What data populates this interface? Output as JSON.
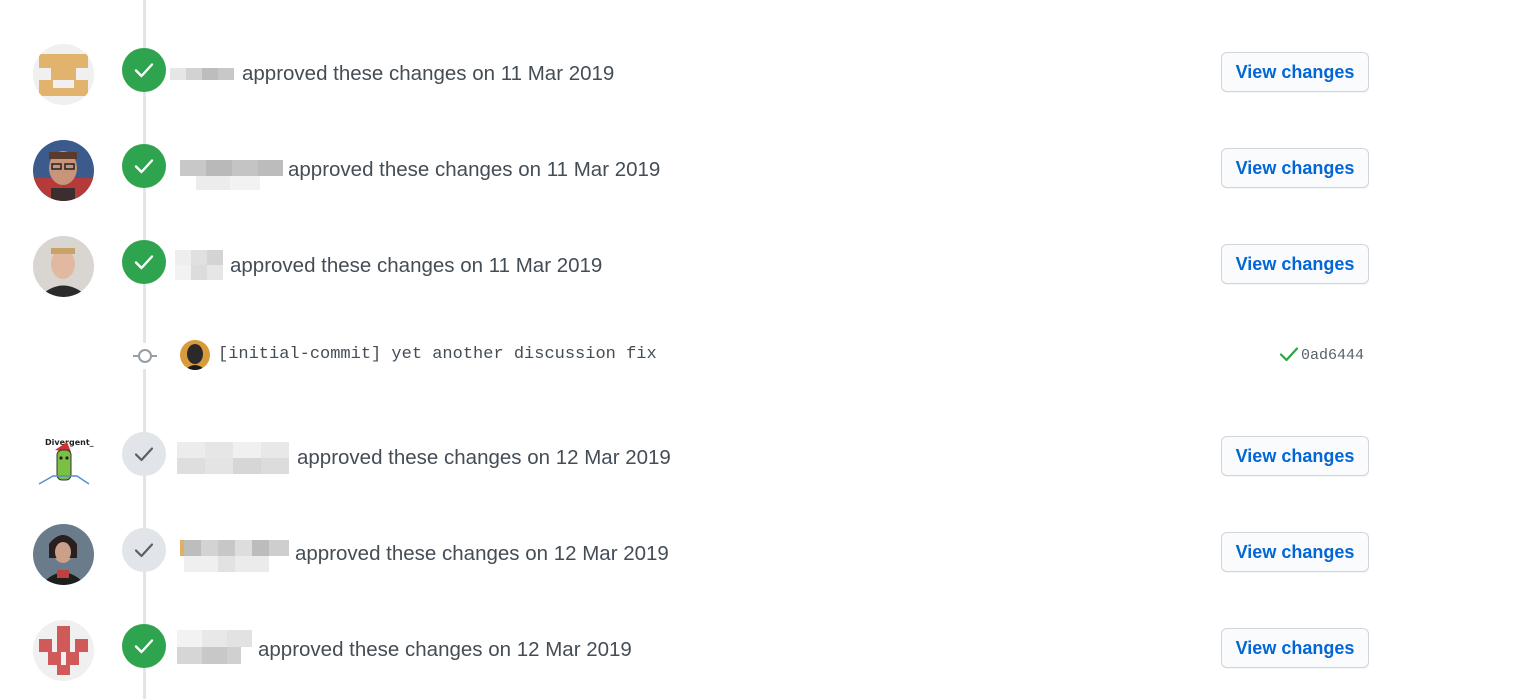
{
  "colors": {
    "approved_badge": "#2ea44f",
    "stale_badge": "#e1e4e8",
    "link_blue": "#0366d6",
    "timeline": "#e1e4e8"
  },
  "reviews": [
    {
      "action": "approved these changes on",
      "date": "11 Mar 2019",
      "button": "View changes",
      "badge_icon": "check-icon",
      "badge_state": "approved"
    },
    {
      "action": "approved these changes on",
      "date": "11 Mar 2019",
      "button": "View changes",
      "badge_icon": "check-icon",
      "badge_state": "approved"
    },
    {
      "action": "approved these changes on",
      "date": "11 Mar 2019",
      "button": "View changes",
      "badge_icon": "check-icon",
      "badge_state": "approved"
    },
    {
      "action": "approved these changes on",
      "date": "12 Mar 2019",
      "button": "View changes",
      "badge_icon": "check-icon",
      "badge_state": "dismissed"
    },
    {
      "action": "approved these changes on",
      "date": "12 Mar 2019",
      "button": "View changes",
      "badge_icon": "check-icon",
      "badge_state": "dismissed"
    },
    {
      "action": "approved these changes on",
      "date": "12 Mar 2019",
      "button": "View changes",
      "badge_icon": "check-icon",
      "badge_state": "approved"
    }
  ],
  "commit": {
    "message": "[initial-commit] yet another discussion fix",
    "sha": "0ad6444",
    "status_icon": "check-icon",
    "node_icon": "git-commit-icon"
  },
  "avatar_texts": {
    "row4": "Divergent_"
  }
}
